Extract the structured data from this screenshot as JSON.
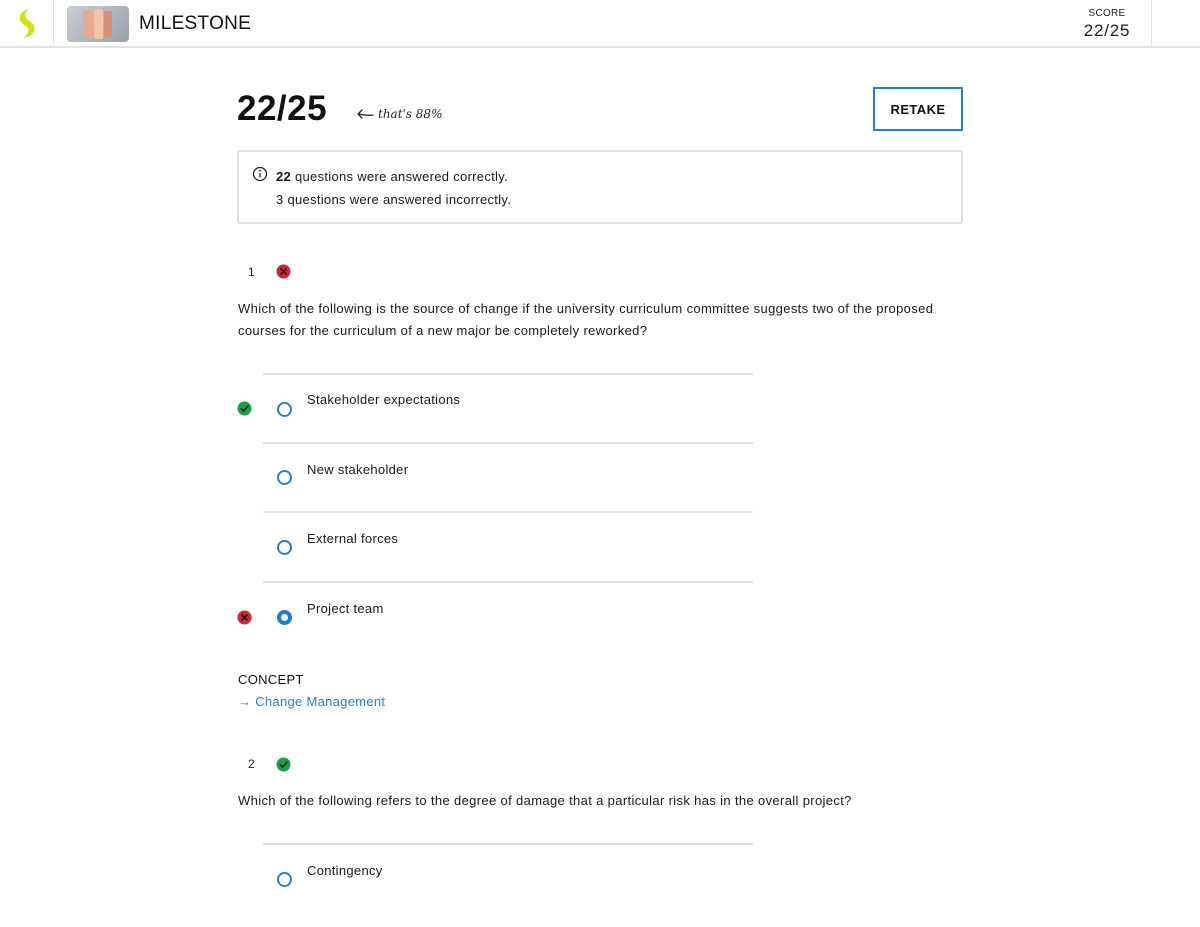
{
  "header": {
    "app_title": "MILESTONE",
    "score_label": "SCORE",
    "score_value": "22/25"
  },
  "result": {
    "score": "22/25",
    "percent_note": "that's 88%",
    "retake_label": "RETAKE"
  },
  "summary": {
    "correct_count": "22",
    "correct_text": " questions were answered correctly.",
    "incorrect_text": "3 questions were answered incorrectly."
  },
  "questions": [
    {
      "number": "1",
      "status": "incorrect",
      "text": "Which of the following is the source of change if the university curriculum committee suggests two of the proposed courses for the curriculum of a new major be completely reworked?",
      "options": [
        {
          "label": "Stakeholder expectations",
          "selected": false,
          "mark": "correct"
        },
        {
          "label": "New stakeholder",
          "selected": false,
          "mark": ""
        },
        {
          "label": "External forces",
          "selected": false,
          "mark": ""
        },
        {
          "label": "Project team",
          "selected": true,
          "mark": "incorrect"
        }
      ],
      "concept_label": "CONCEPT",
      "concept_link": "→ Change Management"
    },
    {
      "number": "2",
      "status": "correct",
      "text": "Which of the following refers to the degree of damage that a particular risk has in the overall project?",
      "options": [
        {
          "label": "Contingency",
          "selected": false,
          "mark": ""
        }
      ]
    }
  ],
  "colors": {
    "accent": "#2b7fbf",
    "correct": "#1f9a4f",
    "incorrect": "#c8283a",
    "logo": "#d4e017"
  }
}
